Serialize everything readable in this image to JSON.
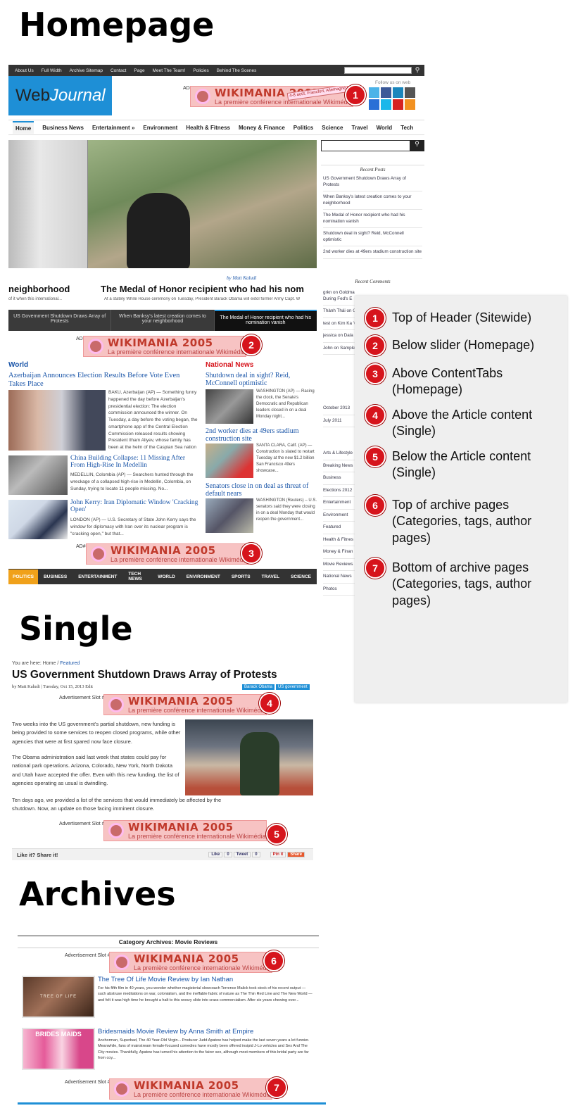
{
  "headings": {
    "homepage": "Homepage",
    "single": "Single",
    "archives": "Archives"
  },
  "topbar": {
    "items": [
      "About Us",
      "Full Width",
      "Archive Sitemap",
      "Contact",
      "Page",
      "Meet The Team!",
      "Policies",
      "Behind The Scenes"
    ]
  },
  "logo": {
    "web": "Web",
    "journal": "Journal"
  },
  "follow": "Follow us on web",
  "nav": {
    "items": [
      "Home",
      "Business News",
      "Entertainment »",
      "Environment",
      "Health & Fitness",
      "Money & Finance",
      "Politics",
      "Science",
      "Travel",
      "World",
      "Tech"
    ]
  },
  "ad": {
    "title": "WIKIMANIA 2005",
    "subtitle": "La première conférence internationale Wikimédia",
    "stamp": "4-8 août, Francfort, Allemagne"
  },
  "ad_labels": {
    "a1": "AD#1",
    "a2": "AD#2",
    "a3": "AD#3",
    "a4": "Advertisement Slot #4",
    "a5": "Advertisement Slot #5",
    "a6": "Advertisement Slot #6",
    "a7": "Advertisement Slot #7"
  },
  "slider": {
    "byline": "by Matt Kaludi",
    "left_title": "neighborhood",
    "left_excerpt": "of it when this international...",
    "main_title": "The Medal of Honor recipient who had his nom",
    "main_excerpt": "At a stately White House ceremony on Tuesday, President Barack Obama will extol former Army Capt. W",
    "tabs": [
      "US Government Shutdown Draws Array of Protests",
      "When Banksy's latest creation comes to your neighborhood",
      "The Medal of Honor recipient who had his nomination vanish"
    ]
  },
  "sidebar": {
    "recent_posts_title": "Recent Posts",
    "recent_posts": [
      "US Government Shutdown Draws Array of Protests",
      "When Banksy's latest creation comes to your neighborhood",
      "The Medal of Honor recipient who had his nomination vanish",
      "Shutdown deal in sight? Reid, McConnell optimistic",
      "2nd worker dies at 49ers stadium construction site"
    ],
    "recent_comments_title": "Recent Comments",
    "recent_comments": [
      "grkn on Goldman Sachs Took Biggest Loan During Fed's E",
      "Thành Thái on C Loan During Fe",
      "test on Kim Ka 'Cosmopolitan,' (PHOTO)",
      "jessica on Dala Meets Spiritual",
      "John on Sample"
    ],
    "archives": [
      "October 2013",
      "July 2011"
    ],
    "categories": [
      "Arts & Lifestyle",
      "Breaking News",
      "Business",
      "Elections 2012",
      "Entertainment",
      "Environment",
      "Featured",
      "Health & Fitnes",
      "Money & Finan",
      "Movie Reviews",
      "National News",
      "Photos"
    ]
  },
  "world": {
    "label": "World",
    "posts": [
      {
        "title": "Azerbaijan Announces Election Results Before Vote Even Takes Place",
        "excerpt": "BAKU, Azerbaijan (AP) — Something funny happened the day before Azerbaijan's presidential election: The election commission announced the winner. On Tuesday, a day before the voting began, the smartphone app of the Central Election Commission released results showing President Ilham Aliyev, whose family has been at the helm of the Caspian Sea nation for four decades, winning..."
      },
      {
        "title": "China Building Collapse: 11 Missing After From High-Rise In Medellin",
        "excerpt": "MEDELLIN, Colombia (AP) — Searchers hunted through the wreckage of a collapsed high-rise in Medellin, Colombia, on Sunday, trying to locate 11 people missing. No..."
      },
      {
        "title": "John Kerry: Iran Diplomatic Window 'Cracking Open'",
        "excerpt": "LONDON (AP) — U.S. Secretary of State John Kerry says the window for diplomacy with Iran over its nuclear program is \"cracking open,\" but that..."
      }
    ]
  },
  "national": {
    "label": "National News",
    "posts": [
      {
        "title": "Shutdown deal in sight? Reid, McConnell optimistic",
        "excerpt": "WASHINGTON (AP) — Racing the clock, the Senate's Democratic and Republican leaders closed in on a deal Monday night..."
      },
      {
        "title": "2nd worker dies at 49ers stadium construction site",
        "excerpt": "SANTA CLARA, Calif. (AP) — Construction is slated to restart Tuesday at the new $1.2 billion San Francisco 49ers showcase..."
      },
      {
        "title": "Senators close in on deal as threat of default nears",
        "excerpt": "WASHINGTON (Reuters) – U.S. senators said they were closing in on a deal Monday that would reopen the government..."
      }
    ]
  },
  "catbar": {
    "items": [
      "POLITICS",
      "BUSINESS",
      "ENTERTAINMENT",
      "TECH NEWS",
      "WORLD",
      "ENVIRONMENT",
      "SPORTS",
      "TRAVEL",
      "SCIENCE"
    ]
  },
  "legend": {
    "items": [
      {
        "num": "1",
        "text": "Top of Header (Sitewide)"
      },
      {
        "num": "2",
        "text": "Below slider (Homepage)"
      },
      {
        "num": "3",
        "text": "Above ContentTabs (Homepage)"
      },
      {
        "num": "4",
        "text": "Above the Article content (Single)"
      },
      {
        "num": "5",
        "text": "Below the Article content (Single)"
      },
      {
        "num": "6",
        "text": "Top of archive pages (Categories, tags, author pages)"
      },
      {
        "num": "7",
        "text": "Bottom of archive pages (Categories, tags, author pages)"
      }
    ]
  },
  "single": {
    "breadcrumb_prefix": "You are here:",
    "breadcrumb_home": "Home",
    "breadcrumb_sep": "/",
    "breadcrumb_current": "Featured",
    "title": "US Government Shutdown Draws Array of Protests",
    "meta": "by Matt Kaludi | Tuesday, Oct 15, 2013 Edit",
    "tags": [
      "Barack Obama",
      "US government"
    ],
    "p1": "Two weeks into the US government's partial shutdown, new funding is being provided to some services to reopen closed programs, while other agencies that were at first spared now face closure.",
    "p2": "The Obama administration said last week that states could pay for national park operations. Arizona, Colorado, New York, North Dakota and Utah have accepted the offer. Even with this new funding, the list of agencies operating as usual is dwindling.",
    "p3": "Ten days ago, we provided a list of the services that would immediately be affected by the shutdown. Now, an update on those facing imminent closure.",
    "share_label": "Like it? Share it!",
    "share_buttons": [
      "Like",
      "0",
      "Tweet",
      "0",
      "Pin it",
      "Share"
    ]
  },
  "archive": {
    "header": "Category Archives: Movie Reviews",
    "posts": [
      {
        "title": "The Tree Of Life Movie Review by Ian Nathan",
        "thumb_text": "TREE OF LIFE",
        "excerpt": "For his fifth film in 40 years, you wonder whether magisterial slowcoach Terrence Malick took stock of his recent output — such abstruse meditations on war, colonialism, and the ineffable fabric of nature as The Thin Red Line and The New World — and felt it was high time he brought a halt to this woozy slide into crass commercialism. After six years chewing over..."
      },
      {
        "title": "Bridesmaids Movie Review by Anna Smith at Empire",
        "thumb_text": "BRIDES MAIDS",
        "excerpt": "Anchorman, Superbad, The 40 Year-Old Virgin... Producer Judd Apatow has helped make the last seven years a lot funnier. Meanwhile, fans of mainstream female-focused comedies have mostly been offered insipid J-Lo vehicles and Sex And The City movies. Thankfully, Apatow has turned his attention to the fairer sex, although most members of this bridal party are far from coy..."
      }
    ]
  },
  "colors": {
    "accent": "#1a55a8",
    "badge": "#d6141c",
    "logo_bg": "#1e8fd6",
    "catbar_active": "#f0a11a"
  }
}
